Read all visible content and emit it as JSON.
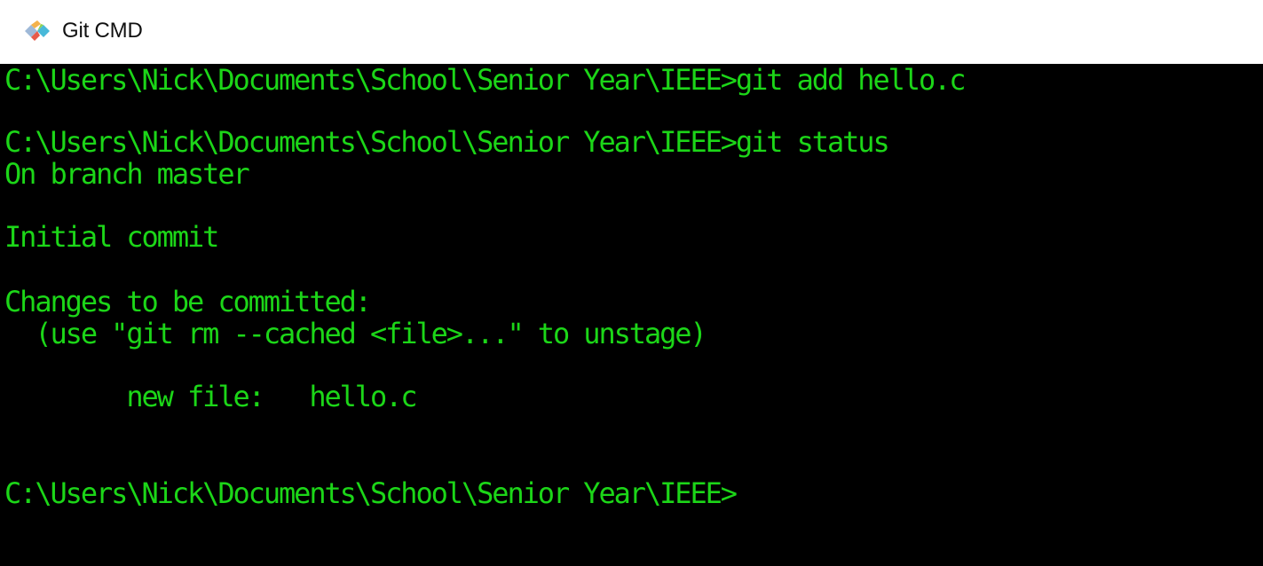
{
  "window": {
    "title": "Git CMD",
    "icon": "git-diamond-icon"
  },
  "console": {
    "text_color": "#1cd618",
    "background": "#000000",
    "lines": [
      "C:\\Users\\Nick\\Documents\\School\\Senior Year\\IEEE>git add hello.c",
      "C:\\Users\\Nick\\Documents\\School\\Senior Year\\IEEE>git status",
      "On branch master",
      "Initial commit",
      "Changes to be committed:",
      "  (use \"git rm --cached <file>...\" to unstage)",
      "        new file:   hello.c",
      "C:\\Users\\Nick\\Documents\\School\\Senior Year\\IEEE>"
    ]
  }
}
